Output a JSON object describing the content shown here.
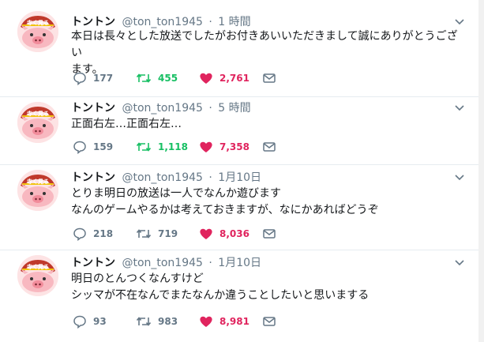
{
  "colors": {
    "retweet_active": "#17bf63",
    "like_active": "#e0245e",
    "muted": "#657786"
  },
  "tweets": [
    {
      "name": "トントン",
      "handle": "@ton_ton1945",
      "dot": "·",
      "time": "1 時間",
      "lines": [
        "本日は長々とした放送でしたがお付きあいいただきまして誠にありがとうござい",
        "ます。"
      ],
      "replies": "177",
      "retweets": "455",
      "likes": "2,761",
      "retweeted": true
    },
    {
      "name": "トントン",
      "handle": "@ton_ton1945",
      "dot": "·",
      "time": "5 時間",
      "lines": [
        "正面右左…正面右左…"
      ],
      "replies": "159",
      "retweets": "1,118",
      "likes": "7,358",
      "retweeted": true
    },
    {
      "name": "トントン",
      "handle": "@ton_ton1945",
      "dot": "·",
      "time": "1月10日",
      "lines": [
        "とりま明日の放送は一人でなんか遊びます",
        "なんのゲームやるかは考えておきますが、なにかあればどうぞ"
      ],
      "replies": "218",
      "retweets": "719",
      "likes": "8,036",
      "retweeted": false
    },
    {
      "name": "トントン",
      "handle": "@ton_ton1945",
      "dot": "·",
      "time": "1月10日",
      "lines": [
        "明日のとんつくなんすけど",
        "シッマが不在なんでまたなんか違うことしたいと思いまする"
      ],
      "replies": "93",
      "retweets": "983",
      "likes": "8,981",
      "retweeted": false
    }
  ]
}
